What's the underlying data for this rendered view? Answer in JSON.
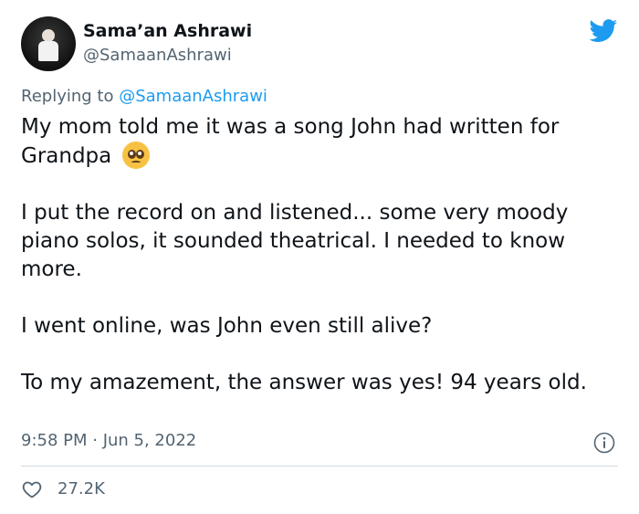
{
  "author": {
    "display_name": "Sama’an Ashrawi",
    "handle": "@SamaanAshrawi"
  },
  "brand": {
    "icon": "twitter-bird-icon",
    "color": "#1d9bf0"
  },
  "reply": {
    "prefix": "Replying to ",
    "mention": "@SamaanAshrawi"
  },
  "body": {
    "para1": "My mom told me it was a song John had written for Grandpa",
    "para1_emoji": "pleading-face-emoji",
    "para2": "I put the record on and listened... some very moody piano solos, it sounded theatrical. I needed to know more.",
    "para3": "I went online, was John even still alive?",
    "para4": "To my amazement, the answer was yes! 94 years old."
  },
  "meta": {
    "timestamp": "9:58 PM · Jun 5, 2022",
    "info_icon": "info-icon"
  },
  "stats": {
    "likes": "27.2K",
    "like_icon": "heart-icon"
  },
  "colors": {
    "text": "#0f1419",
    "secondary": "#536471",
    "link": "#1d9bf0",
    "divider": "#cfd9de"
  }
}
